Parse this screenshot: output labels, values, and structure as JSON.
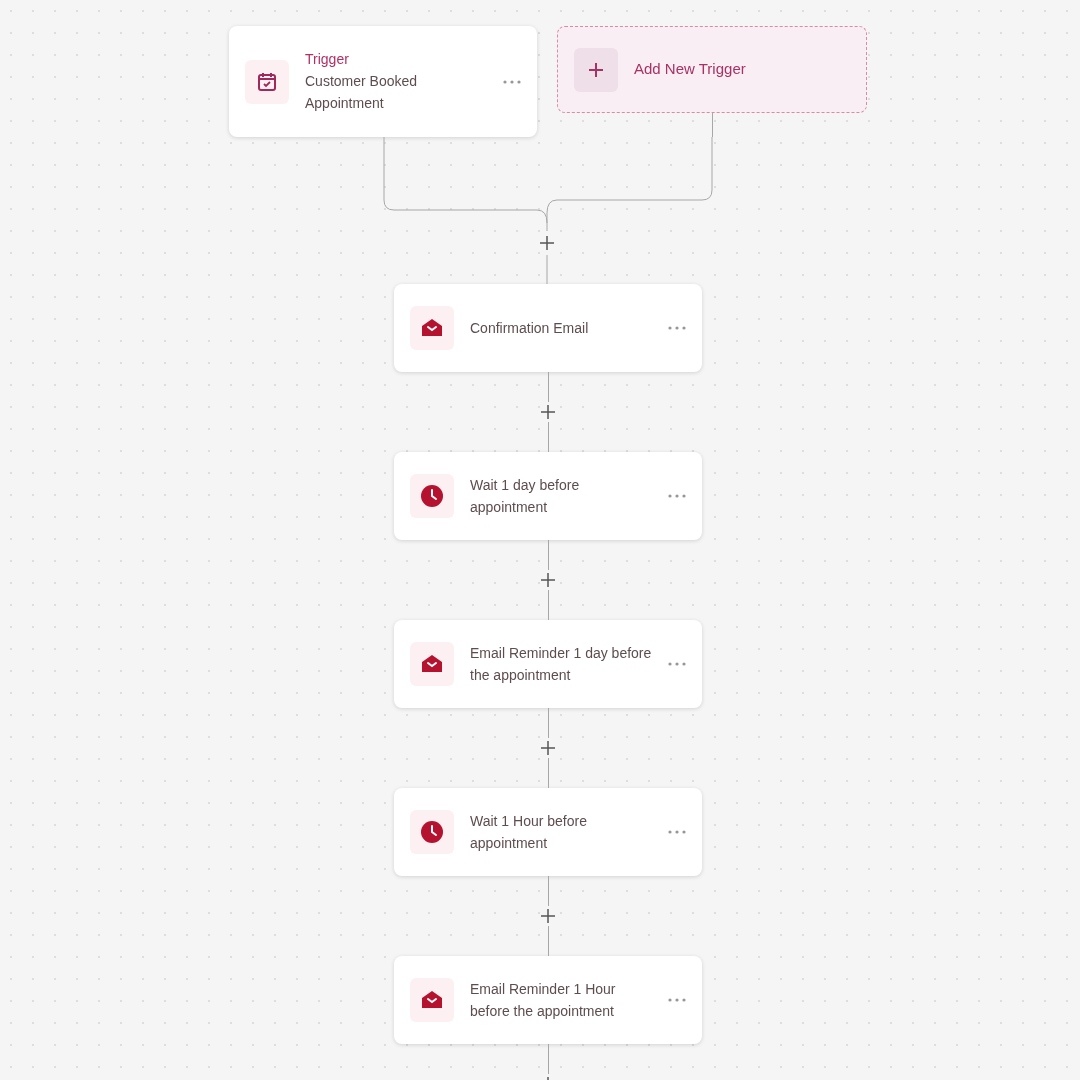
{
  "trigger": {
    "label": "Trigger",
    "title": "Customer Booked Appointment"
  },
  "add_trigger": {
    "label": "Add New Trigger"
  },
  "steps": [
    {
      "kind": "email",
      "title": "Confirmation Email"
    },
    {
      "kind": "wait",
      "title": "Wait 1 day before appointment"
    },
    {
      "kind": "email",
      "title": "Email Reminder 1 day before the appointment"
    },
    {
      "kind": "wait",
      "title": "Wait 1 Hour before appointment"
    },
    {
      "kind": "email",
      "title": "Email Reminder 1 Hour before the appointment"
    }
  ]
}
